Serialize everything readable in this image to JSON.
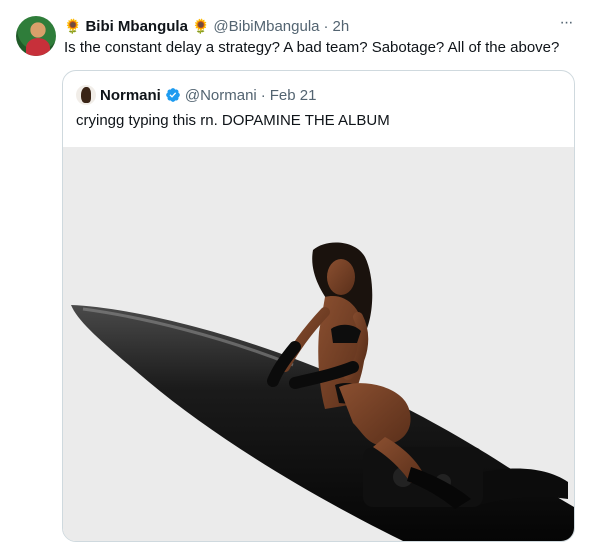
{
  "tweet": {
    "flower_left": "🌻",
    "display_name": "Bibi Mbangula",
    "flower_right": "🌻",
    "handle": "@BibiMbangula",
    "separator": "·",
    "time": "2h",
    "more_label": "···",
    "text": "Is the constant delay a strategy? A bad team? Sabotage? All of the above?"
  },
  "quote": {
    "display_name": "Normani",
    "handle": "@Normani",
    "separator": "·",
    "date": "Feb 21",
    "text": "cryingg typing this rn. DOPAMINE THE ALBUM"
  },
  "colors": {
    "verified": "#1d9bf0",
    "muted": "#536471",
    "border": "#cfd9de"
  },
  "icons": [
    "avatar",
    "sunflower-icon",
    "more-icon",
    "verified-badge-icon"
  ]
}
